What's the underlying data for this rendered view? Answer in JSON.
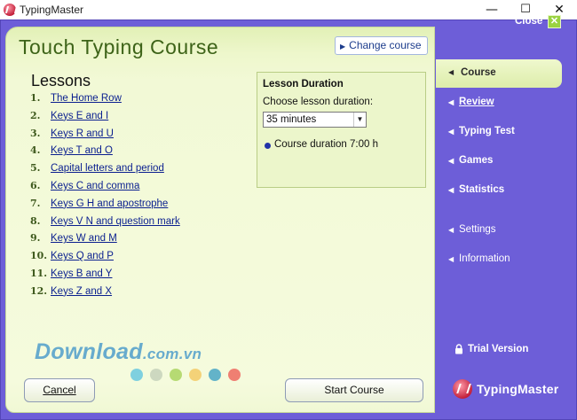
{
  "window": {
    "title": "TypingMaster",
    "minimize": "—",
    "maximize": "☐",
    "close": "✕"
  },
  "header": {
    "title": "Touch Typing Course",
    "change_course": "Change course"
  },
  "lessons": {
    "heading": "Lessons",
    "items": [
      {
        "num": "1.",
        "label": "The Home Row"
      },
      {
        "num": "2.",
        "label": "Keys E and I"
      },
      {
        "num": "3.",
        "label": "Keys R and U"
      },
      {
        "num": "4.",
        "label": "Keys T and O"
      },
      {
        "num": "5.",
        "label": "Capital letters and period"
      },
      {
        "num": "6.",
        "label": "Keys C and comma"
      },
      {
        "num": "7.",
        "label": "Keys G H and apostrophe"
      },
      {
        "num": "8.",
        "label": "Keys V N and question mark"
      },
      {
        "num": "9.",
        "label": "Keys W and M"
      },
      {
        "num": "10.",
        "label": "Keys Q and P"
      },
      {
        "num": "11.",
        "label": "Keys B and Y"
      },
      {
        "num": "12.",
        "label": "Keys Z and X"
      }
    ]
  },
  "duration": {
    "title": "Lesson Duration",
    "label": "Choose lesson duration:",
    "selected": "35 minutes",
    "course_duration": "Course duration 7:00 h"
  },
  "watermark": {
    "main": "Download",
    "suffix": ".com.vn"
  },
  "dot_colors": [
    "#7fd0df",
    "#cdd8c0",
    "#b6da73",
    "#f4d278",
    "#63b3c9",
    "#ef7f72"
  ],
  "buttons": {
    "cancel": "Cancel",
    "start": "Start Course"
  },
  "sidebar": {
    "close": "Close",
    "close_icon": "✕",
    "active": "Course",
    "items": [
      "Review",
      "Typing Test",
      "Games",
      "Statistics"
    ],
    "secondary": [
      "Settings",
      "Information"
    ],
    "trial": "Trial Version",
    "brand": "TypingMaster"
  },
  "colors": {
    "frame": "#6d5ed8",
    "panel": "#f2f9d6",
    "title_green": "#3d6318",
    "link": "#0a1f8f"
  }
}
